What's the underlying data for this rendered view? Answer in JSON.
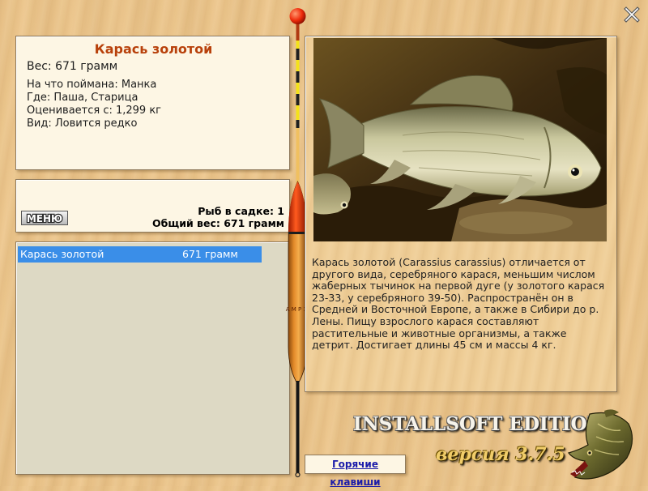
{
  "window": {
    "close_icon": "close-x-icon"
  },
  "fish": {
    "name": "Карась золотой",
    "weight_line": "Вес: 671 грамм",
    "lines": [
      "На что поймана: Манка",
      "Где: Паша, Старица",
      "Оценивается с: 1,299 кг",
      "Вид: Ловится редко"
    ]
  },
  "catch": {
    "menu_label": "МЕНЮ",
    "fish_count": "Рыб в садке: 1",
    "total_weight": "Общий вес: 671 грамм"
  },
  "list": {
    "rows": [
      {
        "name": "Карась золотой",
        "weight": "671 грамм",
        "selected": true
      }
    ]
  },
  "float": {
    "marking": "А М Р 3Г",
    "icon": "fishing-float-icon"
  },
  "description": "Карась золотой (Carassius carassius) отличается от другого вида, серебряного карася, меньшим числом жаберных тычинок на первой дуге (у золотого карася 23-33, у серебряного 39-50). Распространён он в Средней и Восточной Европе, а также в Сибири до р. Лены. Пищу взрослого карася составляют растительные и животные организмы, а также детрит. Достигает длины 45 см и массы 4 кг.",
  "hotkeys": {
    "label": "Горячие клавиши"
  },
  "edition": {
    "title": "INSTALLSOFT EDITION",
    "version": "версия 3.7.5"
  },
  "colors": {
    "title_accent": "#b8410b",
    "selection": "#3a8ee8",
    "version_gold": "#f1cd6a",
    "panel_cream": "#fdf6e4",
    "panel_beige": "#ddd9c4"
  }
}
